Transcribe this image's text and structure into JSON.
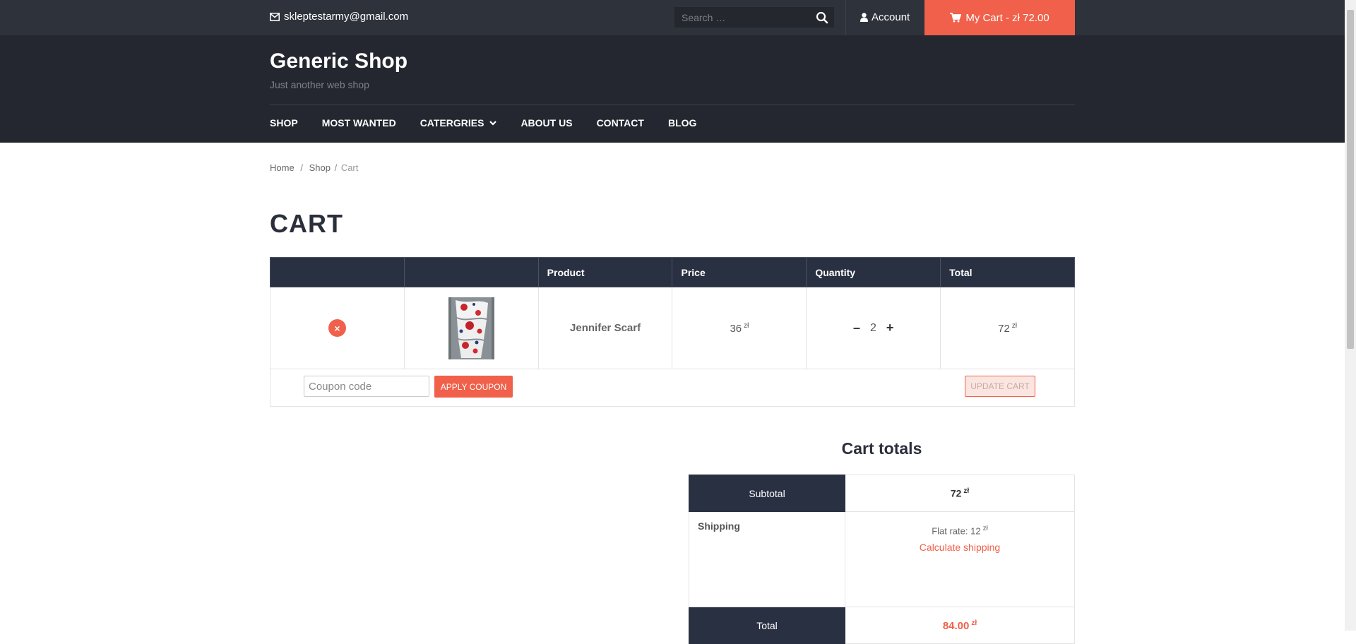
{
  "topbar": {
    "email": "skleptestarmy@gmail.com",
    "search_placeholder": "Search …",
    "account_label": "Account",
    "cart_label": "My Cart - zł 72.00"
  },
  "site": {
    "title": "Generic Shop",
    "tagline": "Just another web shop"
  },
  "nav": {
    "items": [
      "SHOP",
      "MOST WANTED",
      "CATERGRIES",
      "ABOUT US",
      "CONTACT",
      "BLOG"
    ]
  },
  "breadcrumb": {
    "home": "Home",
    "sep1": "/",
    "shop": "Shop",
    "sep2": "/",
    "current": "Cart"
  },
  "page": {
    "title": "CART"
  },
  "cart": {
    "headers": [
      "",
      "",
      "Product",
      "Price",
      "Quantity",
      "Total"
    ],
    "rows": [
      {
        "product": "Jennifer Scarf",
        "price": "36",
        "currency": "zł",
        "qty_minus": "–",
        "quantity": "2",
        "qty_plus": "+",
        "total": "72",
        "remove": "×"
      }
    ],
    "coupon_placeholder": "Coupon code",
    "apply_coupon": "APPLY COUPON",
    "update_cart": "UPDATE CART"
  },
  "totals": {
    "title": "Cart totals",
    "subtotal_label": "Subtotal",
    "subtotal_value": "72",
    "shipping_label": "Shipping",
    "shipping_value": "Flat rate: 12",
    "calculate_shipping": "Calculate shipping",
    "total_label": "Total",
    "total_value": "84.00",
    "currency": "zł"
  },
  "colors": {
    "accent": "#f0604a",
    "topbar": "#2e323b",
    "header": "#24272f",
    "table_head": "#293042"
  }
}
